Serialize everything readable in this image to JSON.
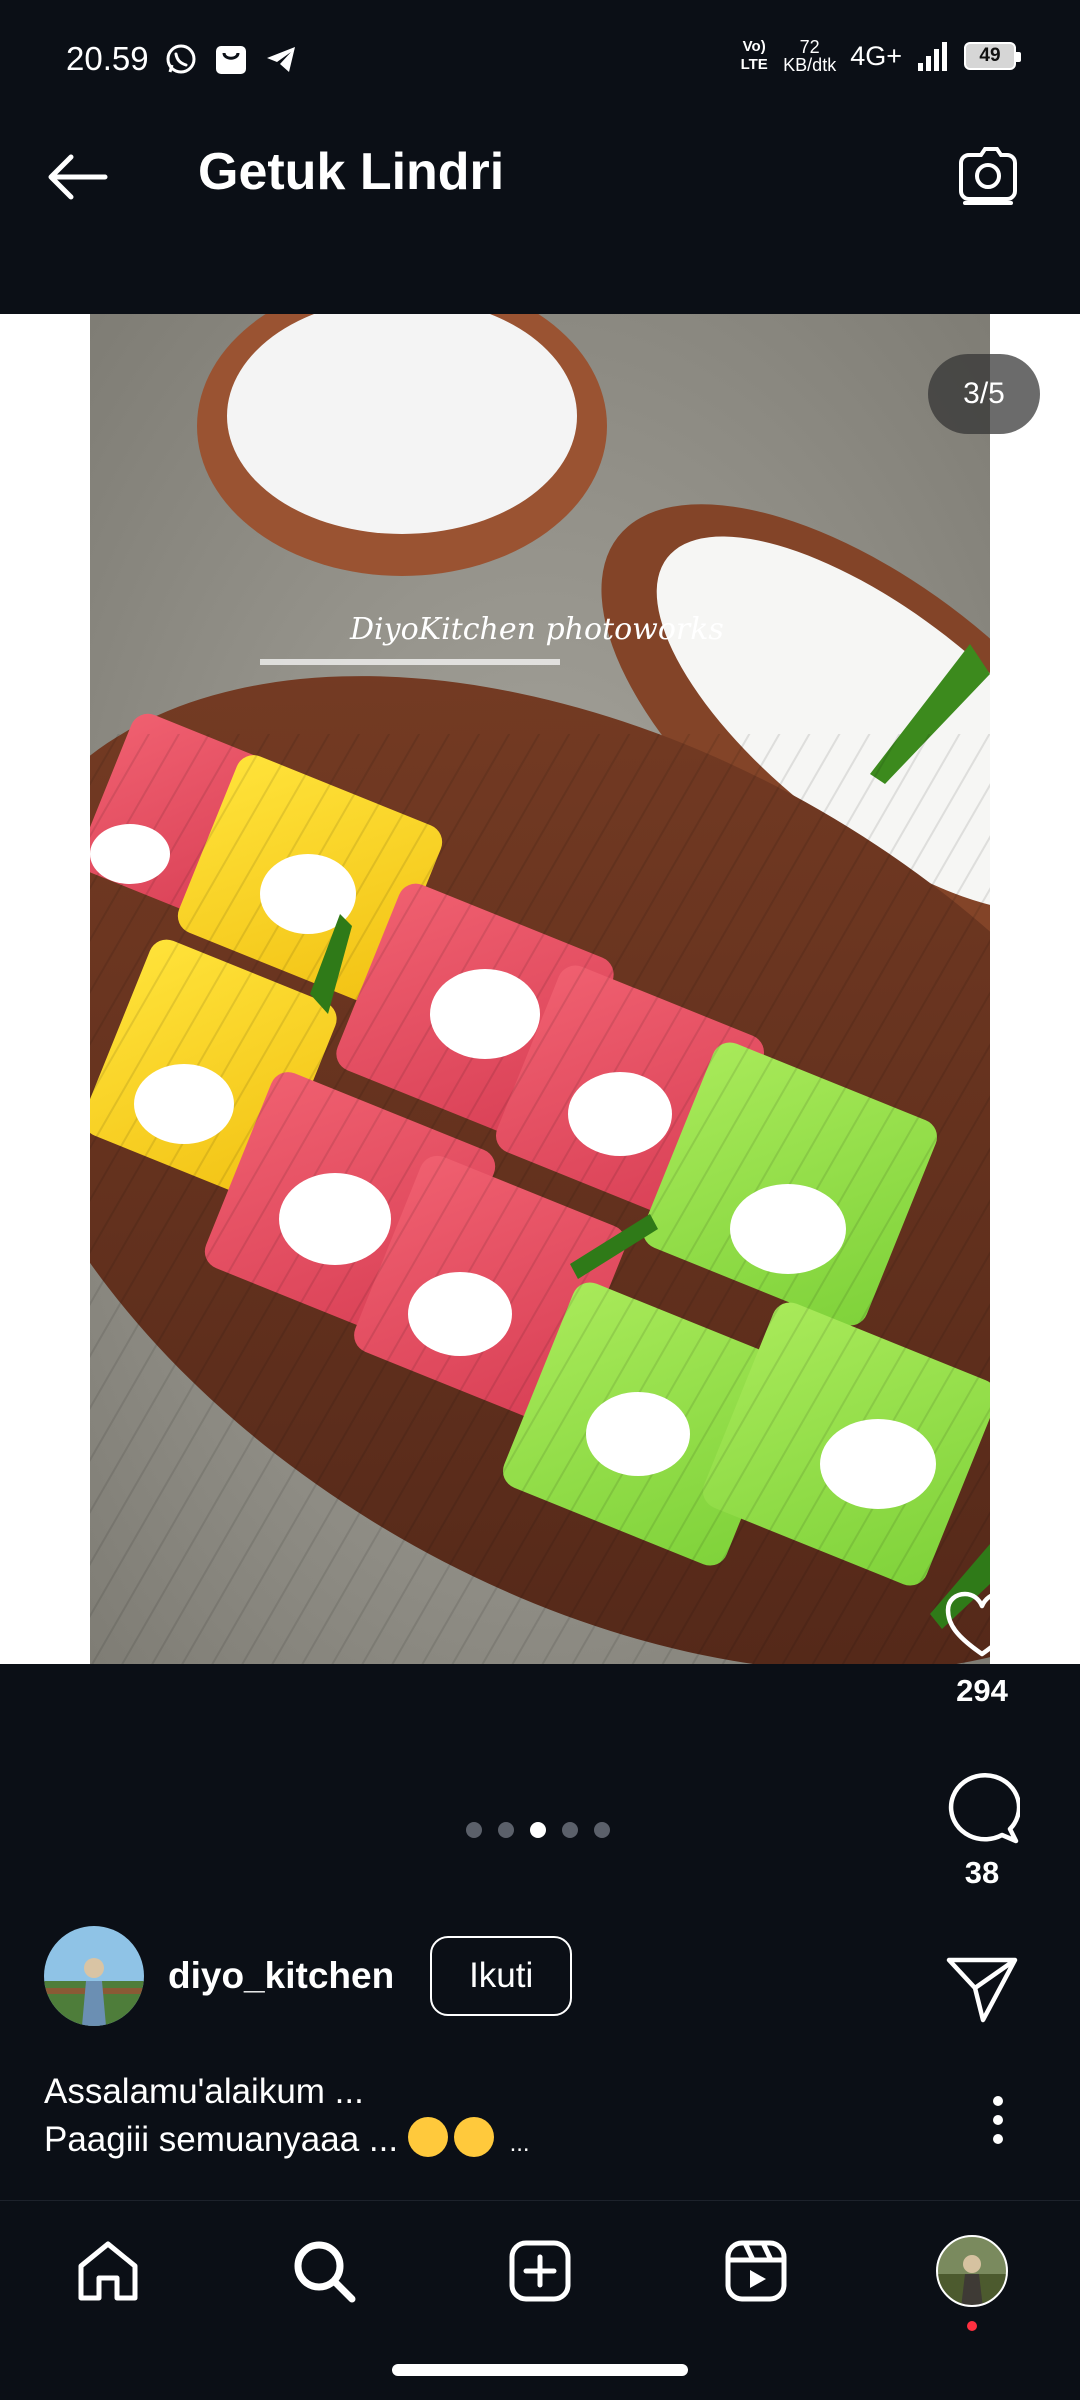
{
  "status_bar": {
    "time": "20.59",
    "network_lte": "Vo) LTE",
    "speed_value": "72",
    "speed_unit": "KB/dtk",
    "network_type": "4G+",
    "battery_level": "49"
  },
  "header": {
    "title": "Getuk Lindri"
  },
  "media": {
    "watermark": "DiyoKitchen photoworks",
    "counter": "3/5",
    "current_index": 3,
    "total": 5
  },
  "actions": {
    "likes": "294",
    "comments": "38"
  },
  "author": {
    "username": "diyo_kitchen",
    "follow_label": "Ikuti"
  },
  "caption": {
    "line1": "Assalamu'alaikum ...",
    "line2_text": "Paagiii semuanyaaa ...",
    "line2_suffix": "..."
  },
  "colors": {
    "background": "#0b0f16",
    "notification_dot": "#ff3040"
  },
  "nav": {
    "items": [
      "home-icon",
      "search-icon",
      "create-icon",
      "reels-icon",
      "profile-avatar"
    ]
  }
}
